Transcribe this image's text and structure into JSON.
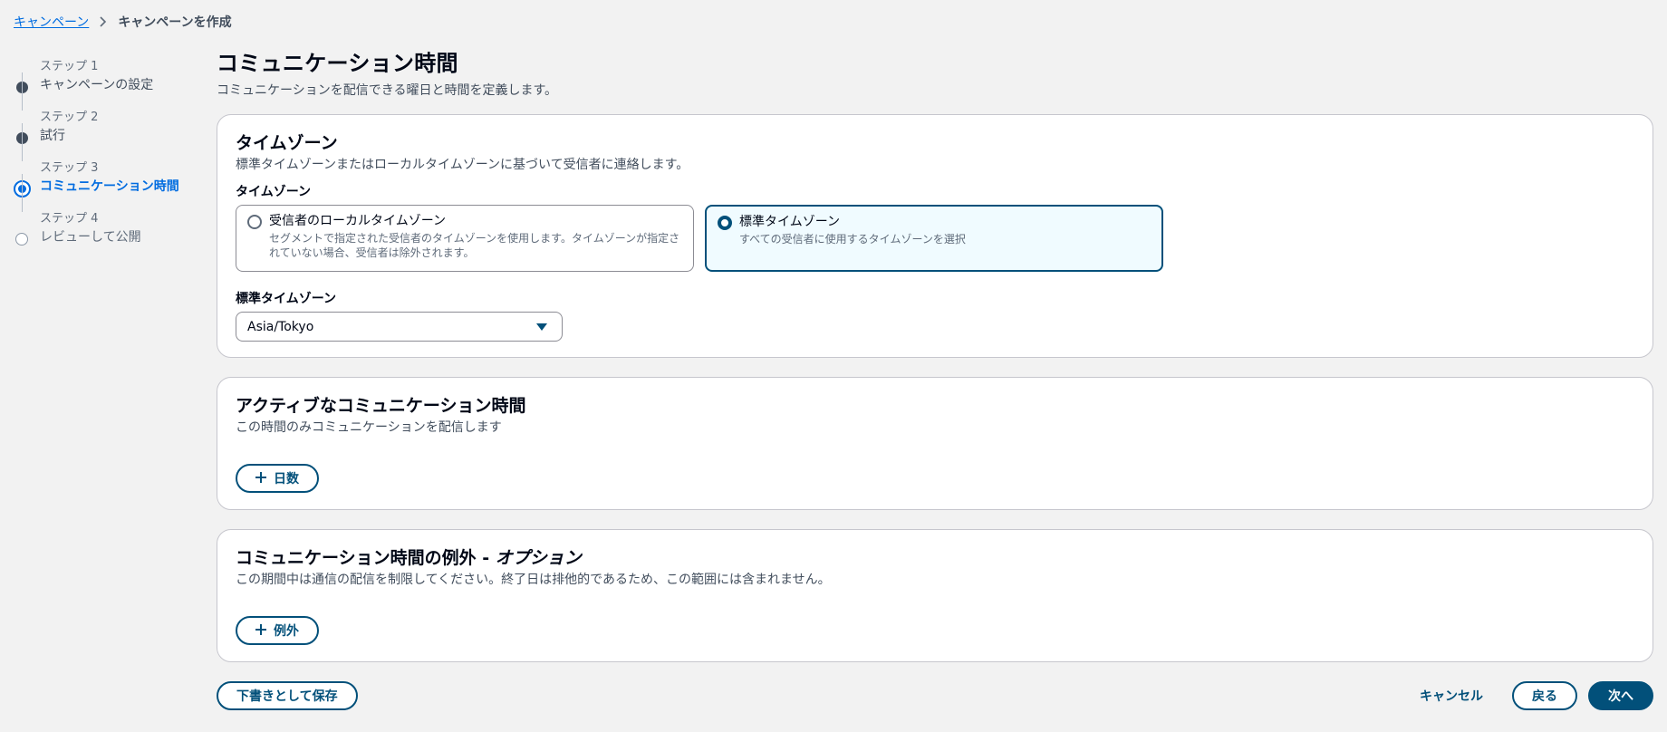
{
  "breadcrumb": {
    "parent": "キャンペーン",
    "current": "キャンペーンを作成"
  },
  "steps": [
    {
      "number": "ステップ 1",
      "name": "キャンペーンの設定",
      "state": "completed"
    },
    {
      "number": "ステップ 2",
      "name": "試行",
      "state": "completed"
    },
    {
      "number": "ステップ 3",
      "name": "コミュニケーション時間",
      "state": "current"
    },
    {
      "number": "ステップ 4",
      "name": "レビューして公開",
      "state": "future"
    }
  ],
  "page": {
    "title": "コミュニケーション時間",
    "description": "コミュニケーションを配信できる曜日と時間を定義します。"
  },
  "timezone": {
    "title": "タイムゾーン",
    "description": "標準タイムゾーンまたはローカルタイムゾーンに基づいて受信者に連絡します。",
    "field_label": "タイムゾーン",
    "options": [
      {
        "title": "受信者のローカルタイムゾーン",
        "description": "セグメントで指定された受信者のタイムゾーンを使用します。タイムゾーンが指定されていない場合、受信者は除外されます。",
        "selected": false
      },
      {
        "title": "標準タイムゾーン",
        "description": "すべての受信者に使用するタイムゾーンを選択",
        "selected": true
      }
    ],
    "standard_label": "標準タイムゾーン",
    "standard_value": "Asia/Tokyo"
  },
  "active_hours": {
    "title": "アクティブなコミュニケーション時間",
    "description": "この時間のみコミュニケーションを配信します",
    "add_button": "日数"
  },
  "exceptions": {
    "title": "コミュニケーション時間の例外 - ",
    "title_optional": "オプション",
    "description": "この期間中は通信の配信を制限してください。終了日は排他的であるため、この範囲には含まれません。",
    "add_button": "例外"
  },
  "footer": {
    "save_draft": "下書きとして保存",
    "cancel": "キャンセル",
    "back": "戻る",
    "next": "次へ"
  },
  "colors": {
    "accent": "#006ce0",
    "button": "#02507a",
    "background": "#f2f2f2"
  }
}
